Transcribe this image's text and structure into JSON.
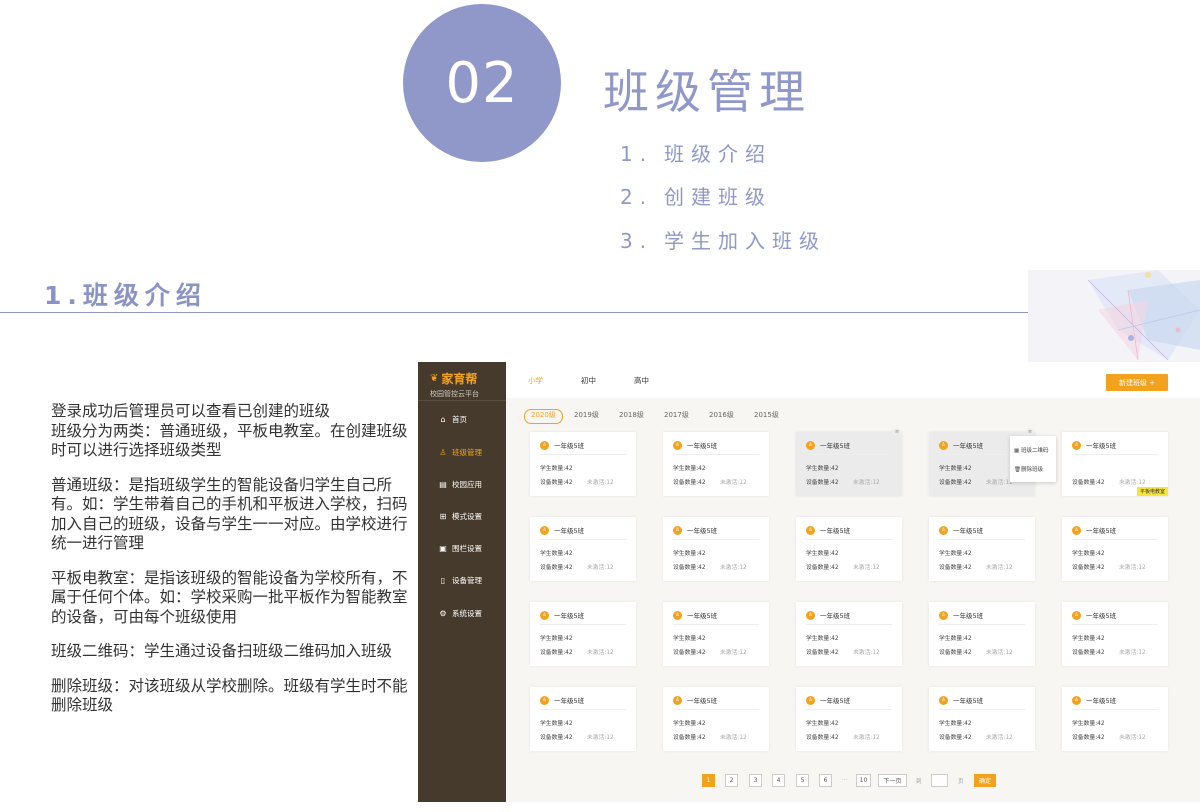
{
  "slide": {
    "number": "02",
    "title": "班级管理",
    "toc": [
      {
        "num": "1.",
        "label": "班级介绍"
      },
      {
        "num": "2.",
        "label": "创建班级"
      },
      {
        "num": "3.",
        "label": "学生加入班级"
      }
    ],
    "section_heading": "1.班级介绍",
    "accent_color": "#8f98c9"
  },
  "description": [
    "登录成功后管理员可以查看已创建的班级\n班级分为两类：普通班级，平板电教室。在创建班级时可以进行选择班级类型",
    "普通班级：是指班级学生的智能设备归学生自己所有。如：学生带着自己的手机和平板进入学校，扫码加入自己的班级，设备与学生一一对应。由学校进行统一进行管理",
    "平板电教室：是指该班级的智能设备为学校所有，不属于任何个体。如：学校采购一批平板作为智能教室的设备，可由每个班级使用",
    "班级二维码：学生通过设备扫班级二维码加入班级",
    "删除班级：对该班级从学校删除。班级有学生时不能删除班级"
  ],
  "app": {
    "brand_name": "家育帮",
    "brand_sub": "校园管控云平台",
    "brand_color": "#f3a21d",
    "nav": [
      {
        "icon": "home-icon",
        "glyph": "⌂",
        "label": "首页",
        "active": false
      },
      {
        "icon": "class-icon",
        "glyph": "♙",
        "label": "班级管理",
        "active": true
      },
      {
        "icon": "app-icon",
        "glyph": "▤",
        "label": "校园应用",
        "active": false
      },
      {
        "icon": "mode-icon",
        "glyph": "⊞",
        "label": "模式设置",
        "active": false
      },
      {
        "icon": "fence-icon",
        "glyph": "▣",
        "label": "围栏设置",
        "active": false
      },
      {
        "icon": "device-icon",
        "glyph": "▯",
        "label": "设备管理",
        "active": false
      },
      {
        "icon": "settings-icon",
        "glyph": "⚙",
        "label": "系统设置",
        "active": false
      }
    ],
    "level_tabs": [
      "小学",
      "初中",
      "高中"
    ],
    "active_level": "小学",
    "new_class_button": "新建班级 +",
    "year_tabs": [
      "2020级",
      "2019级",
      "2018级",
      "2017级",
      "2016级",
      "2015级"
    ],
    "active_year": "2020级",
    "card": {
      "name": "一年级5班",
      "students": "学生数量:42",
      "devices": "设备数量:42",
      "inactive": "未激活:12",
      "menu_glyph": "≡",
      "tablet_tag": "平板电教室"
    },
    "popup": {
      "qr_label": "班级二维码",
      "delete_label": "删除班级"
    },
    "pager": {
      "pages": [
        "1",
        "2",
        "3",
        "4",
        "5",
        "6"
      ],
      "ellipsis": "···",
      "last": "10",
      "next": "下一页",
      "goto_prefix": "到",
      "goto_suffix": "页",
      "confirm": "确定",
      "current": "1"
    }
  }
}
